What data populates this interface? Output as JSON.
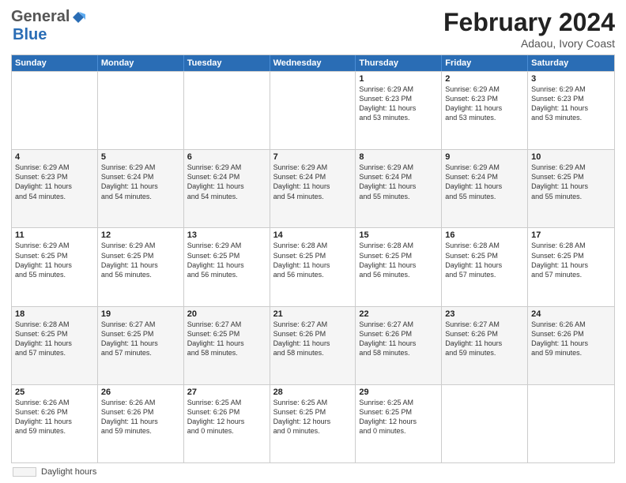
{
  "header": {
    "logo_general": "General",
    "logo_blue": "Blue",
    "month_title": "February 2024",
    "subtitle": "Adaou, Ivory Coast"
  },
  "footer": {
    "legend_label": "Daylight hours"
  },
  "calendar": {
    "days_of_week": [
      "Sunday",
      "Monday",
      "Tuesday",
      "Wednesday",
      "Thursday",
      "Friday",
      "Saturday"
    ],
    "rows": [
      [
        {
          "day": "",
          "info": "",
          "shaded": false
        },
        {
          "day": "",
          "info": "",
          "shaded": false
        },
        {
          "day": "",
          "info": "",
          "shaded": false
        },
        {
          "day": "",
          "info": "",
          "shaded": false
        },
        {
          "day": "1",
          "info": "Sunrise: 6:29 AM\nSunset: 6:23 PM\nDaylight: 11 hours\nand 53 minutes.",
          "shaded": false
        },
        {
          "day": "2",
          "info": "Sunrise: 6:29 AM\nSunset: 6:23 PM\nDaylight: 11 hours\nand 53 minutes.",
          "shaded": false
        },
        {
          "day": "3",
          "info": "Sunrise: 6:29 AM\nSunset: 6:23 PM\nDaylight: 11 hours\nand 53 minutes.",
          "shaded": false
        }
      ],
      [
        {
          "day": "4",
          "info": "Sunrise: 6:29 AM\nSunset: 6:23 PM\nDaylight: 11 hours\nand 54 minutes.",
          "shaded": true
        },
        {
          "day": "5",
          "info": "Sunrise: 6:29 AM\nSunset: 6:24 PM\nDaylight: 11 hours\nand 54 minutes.",
          "shaded": true
        },
        {
          "day": "6",
          "info": "Sunrise: 6:29 AM\nSunset: 6:24 PM\nDaylight: 11 hours\nand 54 minutes.",
          "shaded": true
        },
        {
          "day": "7",
          "info": "Sunrise: 6:29 AM\nSunset: 6:24 PM\nDaylight: 11 hours\nand 54 minutes.",
          "shaded": true
        },
        {
          "day": "8",
          "info": "Sunrise: 6:29 AM\nSunset: 6:24 PM\nDaylight: 11 hours\nand 55 minutes.",
          "shaded": true
        },
        {
          "day": "9",
          "info": "Sunrise: 6:29 AM\nSunset: 6:24 PM\nDaylight: 11 hours\nand 55 minutes.",
          "shaded": true
        },
        {
          "day": "10",
          "info": "Sunrise: 6:29 AM\nSunset: 6:25 PM\nDaylight: 11 hours\nand 55 minutes.",
          "shaded": true
        }
      ],
      [
        {
          "day": "11",
          "info": "Sunrise: 6:29 AM\nSunset: 6:25 PM\nDaylight: 11 hours\nand 55 minutes.",
          "shaded": false
        },
        {
          "day": "12",
          "info": "Sunrise: 6:29 AM\nSunset: 6:25 PM\nDaylight: 11 hours\nand 56 minutes.",
          "shaded": false
        },
        {
          "day": "13",
          "info": "Sunrise: 6:29 AM\nSunset: 6:25 PM\nDaylight: 11 hours\nand 56 minutes.",
          "shaded": false
        },
        {
          "day": "14",
          "info": "Sunrise: 6:28 AM\nSunset: 6:25 PM\nDaylight: 11 hours\nand 56 minutes.",
          "shaded": false
        },
        {
          "day": "15",
          "info": "Sunrise: 6:28 AM\nSunset: 6:25 PM\nDaylight: 11 hours\nand 56 minutes.",
          "shaded": false
        },
        {
          "day": "16",
          "info": "Sunrise: 6:28 AM\nSunset: 6:25 PM\nDaylight: 11 hours\nand 57 minutes.",
          "shaded": false
        },
        {
          "day": "17",
          "info": "Sunrise: 6:28 AM\nSunset: 6:25 PM\nDaylight: 11 hours\nand 57 minutes.",
          "shaded": false
        }
      ],
      [
        {
          "day": "18",
          "info": "Sunrise: 6:28 AM\nSunset: 6:25 PM\nDaylight: 11 hours\nand 57 minutes.",
          "shaded": true
        },
        {
          "day": "19",
          "info": "Sunrise: 6:27 AM\nSunset: 6:25 PM\nDaylight: 11 hours\nand 57 minutes.",
          "shaded": true
        },
        {
          "day": "20",
          "info": "Sunrise: 6:27 AM\nSunset: 6:25 PM\nDaylight: 11 hours\nand 58 minutes.",
          "shaded": true
        },
        {
          "day": "21",
          "info": "Sunrise: 6:27 AM\nSunset: 6:26 PM\nDaylight: 11 hours\nand 58 minutes.",
          "shaded": true
        },
        {
          "day": "22",
          "info": "Sunrise: 6:27 AM\nSunset: 6:26 PM\nDaylight: 11 hours\nand 58 minutes.",
          "shaded": true
        },
        {
          "day": "23",
          "info": "Sunrise: 6:27 AM\nSunset: 6:26 PM\nDaylight: 11 hours\nand 59 minutes.",
          "shaded": true
        },
        {
          "day": "24",
          "info": "Sunrise: 6:26 AM\nSunset: 6:26 PM\nDaylight: 11 hours\nand 59 minutes.",
          "shaded": true
        }
      ],
      [
        {
          "day": "25",
          "info": "Sunrise: 6:26 AM\nSunset: 6:26 PM\nDaylight: 11 hours\nand 59 minutes.",
          "shaded": false
        },
        {
          "day": "26",
          "info": "Sunrise: 6:26 AM\nSunset: 6:26 PM\nDaylight: 11 hours\nand 59 minutes.",
          "shaded": false
        },
        {
          "day": "27",
          "info": "Sunrise: 6:25 AM\nSunset: 6:26 PM\nDaylight: 12 hours\nand 0 minutes.",
          "shaded": false
        },
        {
          "day": "28",
          "info": "Sunrise: 6:25 AM\nSunset: 6:25 PM\nDaylight: 12 hours\nand 0 minutes.",
          "shaded": false
        },
        {
          "day": "29",
          "info": "Sunrise: 6:25 AM\nSunset: 6:25 PM\nDaylight: 12 hours\nand 0 minutes.",
          "shaded": false
        },
        {
          "day": "",
          "info": "",
          "shaded": false
        },
        {
          "day": "",
          "info": "",
          "shaded": false
        }
      ]
    ]
  }
}
